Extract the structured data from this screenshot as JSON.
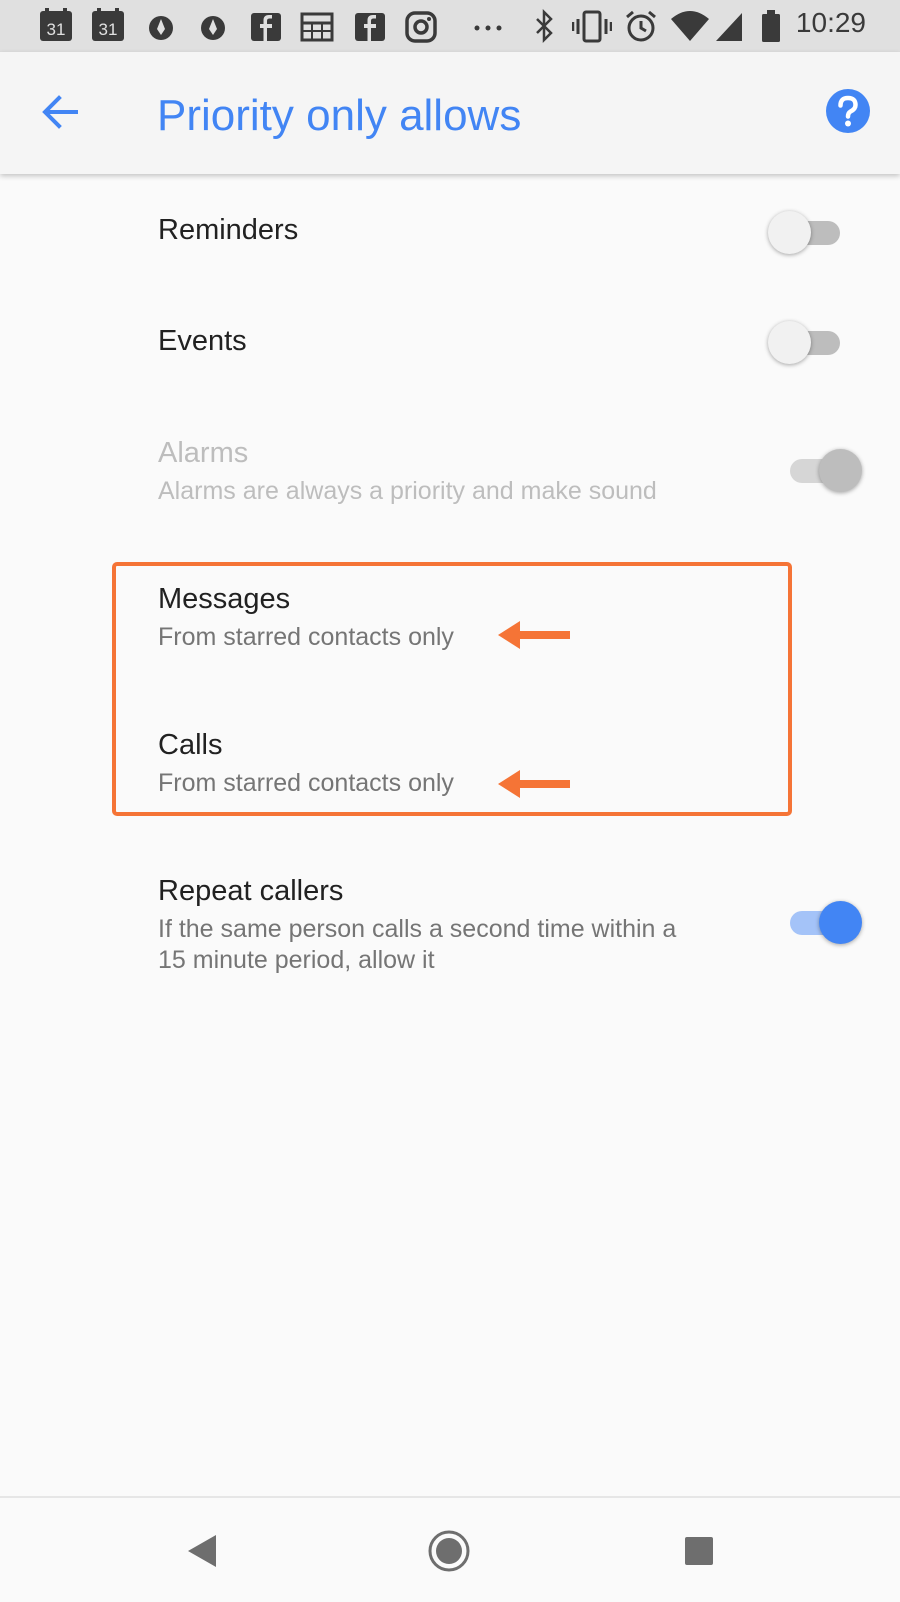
{
  "status_bar": {
    "time": "10:29",
    "calendar_day": "31",
    "icons": [
      "calendar-icon",
      "calendar-icon",
      "app-icon",
      "app-icon",
      "facebook-icon",
      "sheets-icon",
      "facebook-icon",
      "instagram-icon",
      "more-icon",
      "bluetooth-icon",
      "vibrate-icon",
      "alarm-icon",
      "wifi-icon",
      "signal-icon",
      "battery-icon"
    ]
  },
  "app_bar": {
    "title": "Priority only allows",
    "back_icon": "back-arrow-icon",
    "help_icon": "help-icon"
  },
  "preferences": {
    "reminders": {
      "title": "Reminders",
      "state": "off"
    },
    "events": {
      "title": "Events",
      "state": "off"
    },
    "alarms": {
      "title": "Alarms",
      "summary": "Alarms are always a priority and make sound",
      "state": "on-disabled"
    },
    "messages": {
      "title": "Messages",
      "summary": "From starred contacts only"
    },
    "calls": {
      "title": "Calls",
      "summary": "From starred contacts only"
    },
    "repeat_callers": {
      "title": "Repeat callers",
      "summary_line1": "If the same person calls a second time within a",
      "summary_line2": "15 minute period, allow it",
      "state": "on"
    }
  },
  "annotation": {
    "color": "#f57436",
    "icon": "arrow-left-icon"
  },
  "colors": {
    "accent": "#4285f4",
    "highlight": "#f57436"
  },
  "nav_bar": {
    "icons": [
      "nav-back-icon",
      "nav-home-icon",
      "nav-recents-icon"
    ]
  }
}
